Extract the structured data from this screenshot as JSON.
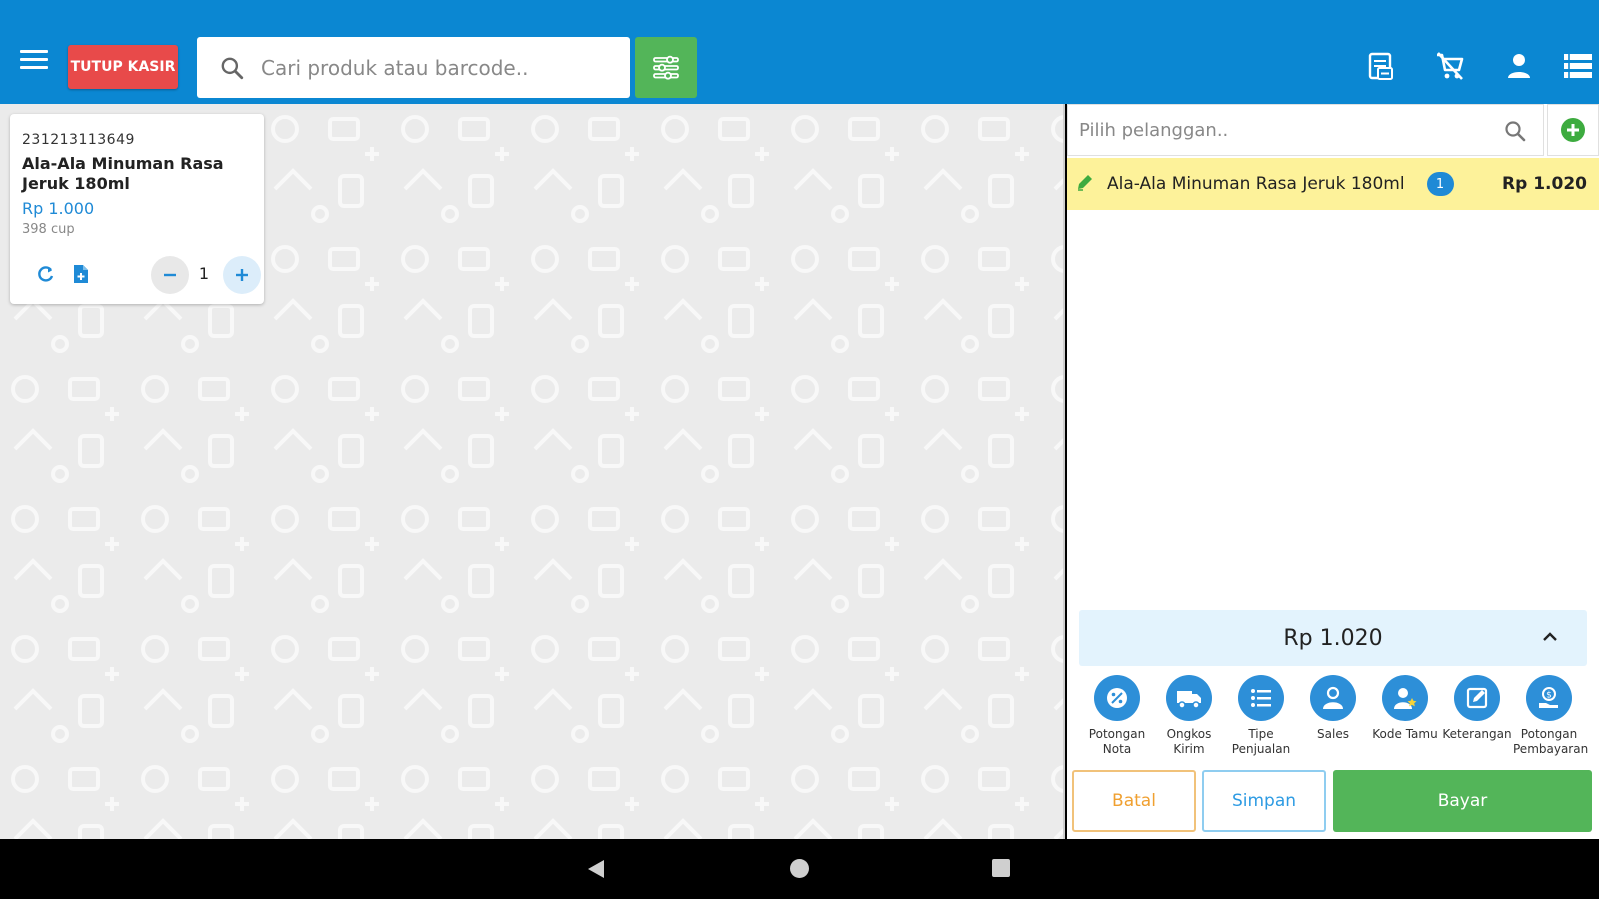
{
  "header": {
    "close_cashier_label": "TUTUP KASIR",
    "search_placeholder": "Cari produk atau barcode.."
  },
  "product": {
    "code": "231213113649",
    "name": "Ala-Ala Minuman Rasa Jeruk 180ml",
    "price": "Rp 1.000",
    "stock": "398 cup",
    "quantity": "1"
  },
  "customer": {
    "search_placeholder": "Pilih pelanggan.."
  },
  "cart": {
    "items": [
      {
        "name": "Ala-Ala Minuman Rasa Jeruk 180ml",
        "qty": "1",
        "price": "Rp 1.020"
      }
    ],
    "total": "Rp 1.020"
  },
  "actions": [
    {
      "label": "Potongan Nota",
      "icon": "discount-icon"
    },
    {
      "label": "Ongkos Kirim",
      "icon": "truck-icon"
    },
    {
      "label": "Tipe Penjualan",
      "icon": "list-icon"
    },
    {
      "label": "Sales",
      "icon": "person-icon"
    },
    {
      "label": "Kode Tamu",
      "icon": "guest-icon"
    },
    {
      "label": "Keterangan",
      "icon": "note-edit-icon"
    },
    {
      "label": "Potongan Pembayaran",
      "icon": "payment-hand-icon"
    }
  ],
  "buttons": {
    "cancel": "Batal",
    "save": "Simpan",
    "pay": "Bayar"
  },
  "colors": {
    "topbar": "#0b87d2",
    "danger": "#e84a4a",
    "success": "#53b559",
    "accent": "#1f8ad6",
    "highlight": "#fdf29a"
  }
}
